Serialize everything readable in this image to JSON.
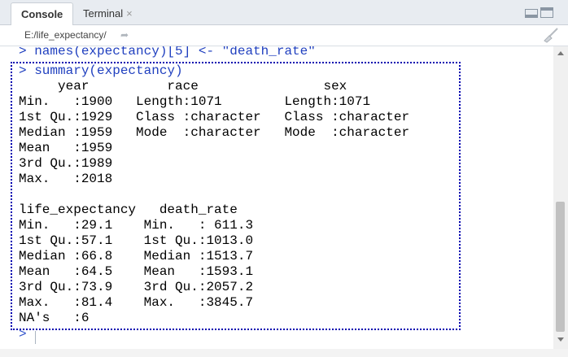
{
  "tabs": [
    {
      "label": "Console",
      "active": true
    },
    {
      "label": "Terminal",
      "close": "×"
    }
  ],
  "path": "E:/life_expectancy/",
  "icons": {
    "goto": "arrow-share-icon",
    "clear": "broom-icon",
    "minimize": "minimize-icon",
    "maximize": "maximize-icon"
  },
  "console": {
    "prev_command": "> names(expectancy)[5] <- \"death_rate\"",
    "command": "> summary(expectancy)",
    "output": [
      "     year          race                sex           ",
      "Min.   :1900   Length:1071        Length:1071       ",
      "1st Qu.:1929   Class :character   Class :character  ",
      "Median :1959   Mode  :character   Mode  :character  ",
      "Mean   :1959                                        ",
      "3rd Qu.:1989                                        ",
      "Max.   :2018                                        ",
      "",
      "life_expectancy   death_rate    ",
      "Min.   :29.1    Min.   : 611.3  ",
      "1st Qu.:57.1    1st Qu.:1013.0  ",
      "Median :66.8    Median :1513.7  ",
      "Mean   :64.5    Mean   :1593.1  ",
      "3rd Qu.:73.9    3rd Qu.:2057.2  ",
      "Max.   :81.4    Max.   :3845.7  ",
      "NA's   :6                       "
    ],
    "prompt": ">"
  },
  "colors": {
    "command": "#1f3fbf",
    "highlight_border": "#0000b0"
  }
}
